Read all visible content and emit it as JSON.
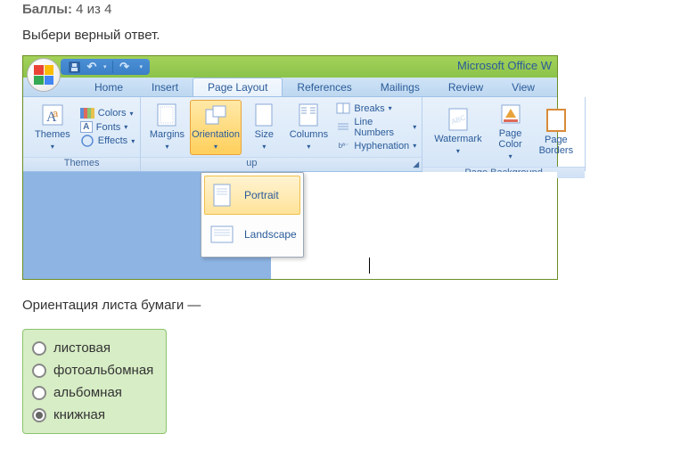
{
  "score": {
    "label": "Баллы:",
    "value": "4 из 4"
  },
  "prompt": "Выбери верный ответ.",
  "app_title": "Microsoft Office W",
  "tabs": {
    "home": "Home",
    "insert": "Insert",
    "page_layout": "Page Layout",
    "references": "References",
    "mailings": "Mailings",
    "review": "Review",
    "view": "View"
  },
  "ribbon": {
    "themes": {
      "label": "Themes",
      "themes_btn": "Themes",
      "colors": "Colors",
      "fonts": "Fonts",
      "effects": "Effects"
    },
    "page_setup": {
      "label_partial": "up",
      "margins": "Margins",
      "orientation": "Orientation",
      "size": "Size",
      "columns": "Columns",
      "breaks": "Breaks",
      "line_numbers": "Line Numbers",
      "hyphenation": "Hyphenation"
    },
    "page_bg": {
      "label": "Page Background",
      "watermark": "Watermark",
      "page_color": "Page\nColor",
      "page_borders": "Page\nBorders"
    }
  },
  "orientation_menu": {
    "portrait": "Portrait",
    "landscape": "Landscape"
  },
  "question": "Ориентация листа бумаги —",
  "answers": {
    "a1": "листовая",
    "a2": "фотоальбомная",
    "a3": "альбомная",
    "a4": "книжная"
  },
  "selected_answer": "a4"
}
